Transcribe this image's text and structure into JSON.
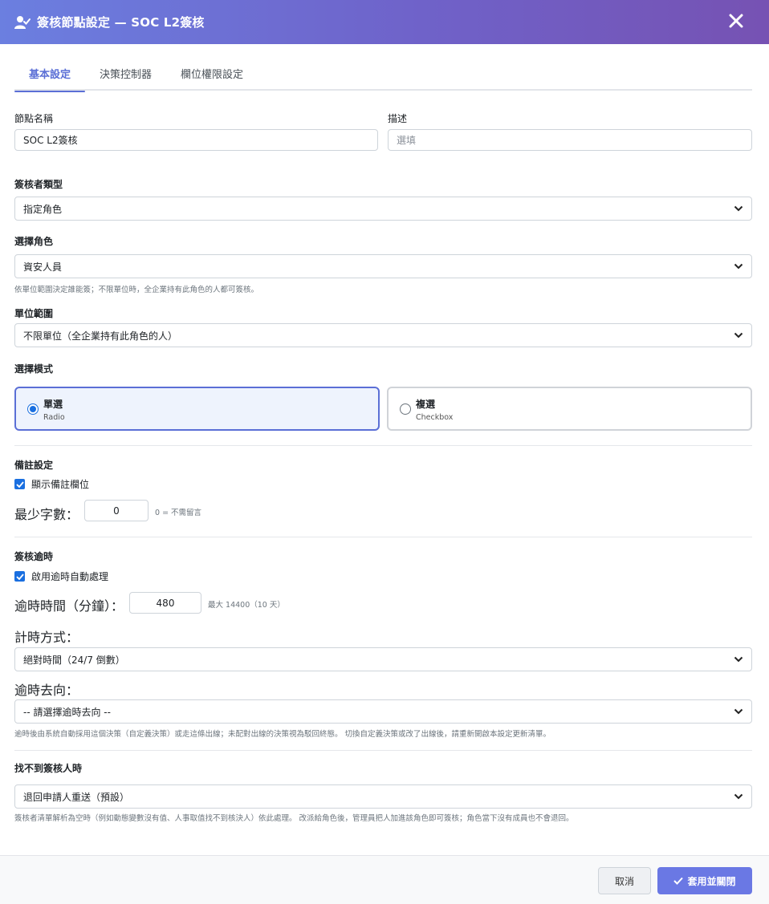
{
  "header": {
    "title": "簽核節點設定 — SOC L2簽核",
    "icon": "user-check-icon",
    "close_icon": "close-icon"
  },
  "tabs": [
    {
      "label": "基本設定",
      "active": true
    },
    {
      "label": "決策控制器",
      "active": false
    },
    {
      "label": "欄位權限設定",
      "active": false
    }
  ],
  "basic": {
    "node_name_label": "節點名稱",
    "node_name_value": "SOC L2簽核",
    "description_label": "描述",
    "description_placeholder": "選填",
    "approver_type_label": "簽核者類型",
    "approver_type_value": "指定角色",
    "role_label": "選擇角色",
    "role_value": "資安人員",
    "role_hint": "依單位範圍決定誰能簽；不限單位時，全企業持有此角色的人都可簽核。",
    "scope_label": "單位範圍",
    "scope_value": "不限單位（全企業持有此角色的人）",
    "mode_label": "選擇模式",
    "mode_options": [
      {
        "title": "單選",
        "subtitle": "Radio",
        "selected": true
      },
      {
        "title": "複選",
        "subtitle": "Checkbox",
        "selected": false
      }
    ]
  },
  "remark": {
    "section_label": "備註設定",
    "show_label": "顯示備註欄位",
    "show_checked": true,
    "min_chars_label": "最少字數：",
    "min_chars_value": "0",
    "min_chars_hint": "0 = 不需留言"
  },
  "timeout": {
    "section_label": "簽核逾時",
    "enable_label": "啟用逾時自動處理",
    "enable_checked": true,
    "minutes_label": "逾時時間（分鐘）：",
    "minutes_value": "480",
    "minutes_hint": "最大 14400（10 天）",
    "timing_label": "計時方式：",
    "timing_value": "絕對時間（24/7 倒數）",
    "direction_label": "逾時去向：",
    "direction_value": "-- 請選擇逾時去向 --",
    "direction_hint": "逾時後由系統自動採用這個決策（自定義決策）或走這條出線；未配對出線的決策視為駁回終態。 切換自定義決策或改了出線後，請重新開啟本設定更新清單。"
  },
  "not_found": {
    "section_label": "找不到簽核人時",
    "value": "退回申請人重送（預設）",
    "hint": "簽核者清單解析為空時（例如動態變數沒有值、人事取值找不到核決人）依此處理。 改派給角色後，管理員把人加進該角色即可簽核；角色當下沒有成員也不會退回。"
  },
  "footer": {
    "cancel_label": "取消",
    "apply_label": "套用並關閉",
    "apply_icon": "check-icon"
  },
  "colors": {
    "accent": "#5b6fd6",
    "header_start": "#6b7fe0",
    "header_end": "#7652b3",
    "checkbox": "#1a6fe0"
  }
}
